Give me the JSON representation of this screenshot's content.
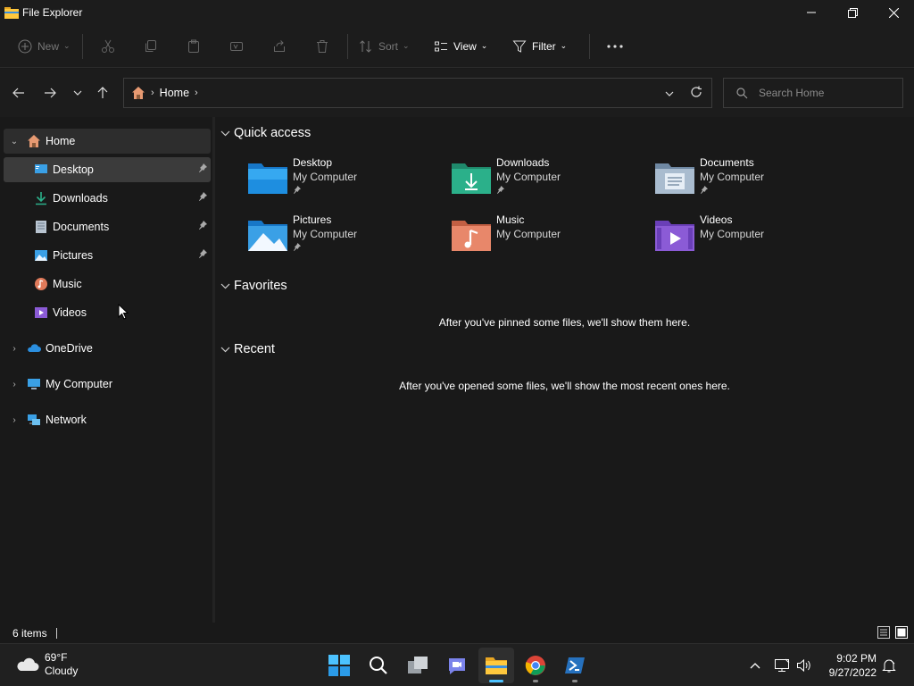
{
  "window": {
    "title": "File Explorer"
  },
  "commandbar": {
    "new_label": "New",
    "sort_label": "Sort",
    "view_label": "View",
    "filter_label": "Filter"
  },
  "address": {
    "crumb": "Home",
    "search_placeholder": "Search Home"
  },
  "sidebar": {
    "home": "Home",
    "pinned": [
      {
        "label": "Desktop",
        "icon": "desktop-icon"
      },
      {
        "label": "Downloads",
        "icon": "downloads-icon"
      },
      {
        "label": "Documents",
        "icon": "documents-icon"
      },
      {
        "label": "Pictures",
        "icon": "pictures-icon"
      },
      {
        "label": "Music",
        "icon": "music-icon"
      },
      {
        "label": "Videos",
        "icon": "videos-icon"
      }
    ],
    "roots": [
      {
        "label": "OneDrive",
        "icon": "onedrive-icon"
      },
      {
        "label": "My Computer",
        "icon": "computer-icon"
      },
      {
        "label": "Network",
        "icon": "network-icon"
      }
    ]
  },
  "content": {
    "quick_access": {
      "title": "Quick access",
      "items": [
        {
          "name": "Desktop",
          "sub": "My Computer",
          "color": "#1e9be8"
        },
        {
          "name": "Downloads",
          "sub": "My Computer",
          "color": "#2bb08a"
        },
        {
          "name": "Documents",
          "sub": "My Computer",
          "color": "#8aa4c0"
        },
        {
          "name": "Pictures",
          "sub": "My Computer",
          "color": "#3aa0e6"
        },
        {
          "name": "Music",
          "sub": "My Computer",
          "color": "#e07a5a"
        },
        {
          "name": "Videos",
          "sub": "My Computer",
          "color": "#8b5bd6"
        }
      ]
    },
    "favorites": {
      "title": "Favorites",
      "empty": "After you've pinned some files, we'll show them here."
    },
    "recent": {
      "title": "Recent",
      "empty": "After you've opened some files, we'll show the most recent ones here."
    }
  },
  "status": {
    "count": "6 items"
  },
  "taskbar": {
    "weather_temp": "69°F",
    "weather_cond": "Cloudy",
    "time": "9:02 PM",
    "date": "9/27/2022",
    "accent": "#4cc2ff"
  }
}
